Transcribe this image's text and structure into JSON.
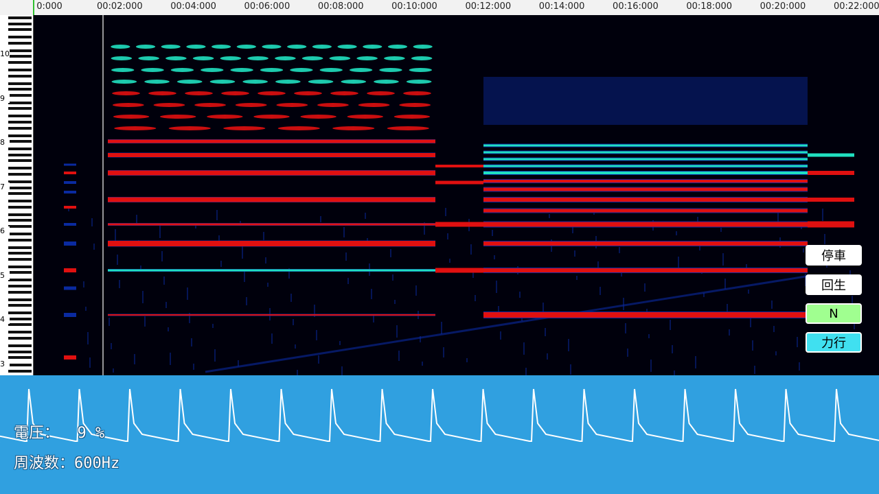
{
  "timeline": {
    "ticks": [
      "0:000",
      "00:02:000",
      "00:04:000",
      "00:06:000",
      "00:08:000",
      "00:10:000",
      "00:12:000",
      "00:14:000",
      "00:16:000",
      "00:18:000",
      "00:20:000",
      "00:22:000"
    ]
  },
  "keyboard": {
    "octave_labels": [
      "10",
      "9",
      "8",
      "7",
      "6",
      "5",
      "4",
      "3"
    ]
  },
  "spectrogram": {
    "colors": {
      "background": "#00000c",
      "low": "#0a2aa0",
      "mid": "#20e0c0",
      "high": "#e01010",
      "cursor": "#c8c8c8"
    }
  },
  "controls": {
    "stop_label": "停車",
    "regen_label": "回生",
    "neutral_label": "N",
    "power_label": "力行",
    "neutral_color": "#a0ff90",
    "power_color": "#40e0f0",
    "default_color": "#ffffff"
  },
  "info": {
    "voltage_label": "電圧：",
    "voltage_value": "  9 %",
    "frequency_label": "周波数：",
    "frequency_value": "600Hz"
  },
  "waveform": {
    "color": "#ffffff",
    "background": "#30a0e0"
  }
}
